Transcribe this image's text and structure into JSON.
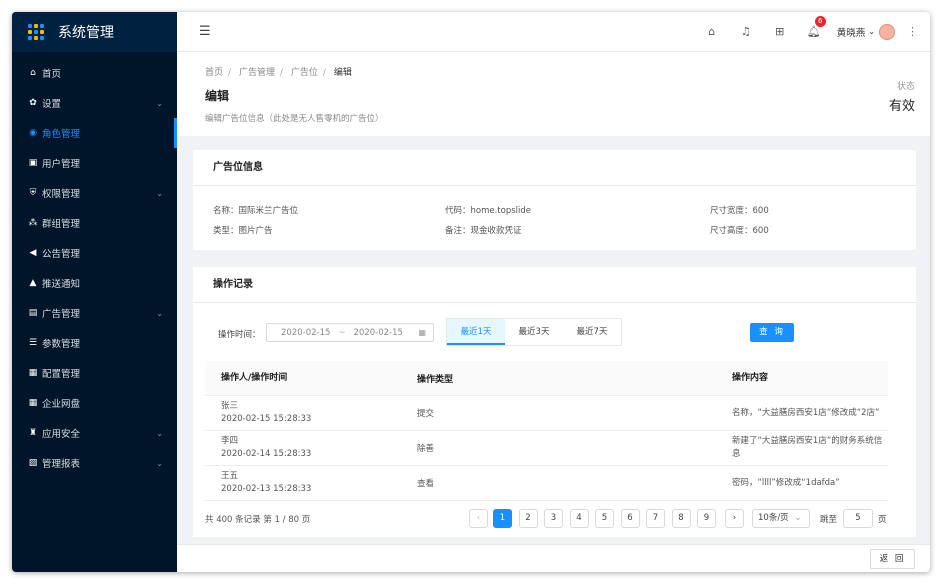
{
  "app": {
    "title": "系统管理"
  },
  "sidebar": {
    "items": [
      {
        "label": "首页",
        "icon": "home-icon",
        "glyph": "⌂",
        "has_children": false
      },
      {
        "label": "设置",
        "icon": "gear-icon",
        "glyph": "✿",
        "has_children": true
      },
      {
        "label": "角色管理",
        "icon": "user-circle-icon",
        "glyph": "◉",
        "has_children": false,
        "active": true
      },
      {
        "label": "用户管理",
        "icon": "id-card-icon",
        "glyph": "▣",
        "has_children": false
      },
      {
        "label": "权限管理",
        "icon": "shield-icon",
        "glyph": "⛨",
        "has_children": true
      },
      {
        "label": "群组管理",
        "icon": "group-icon",
        "glyph": "⁂",
        "has_children": false
      },
      {
        "label": "公告管理",
        "icon": "megaphone-icon",
        "glyph": "◀",
        "has_children": false
      },
      {
        "label": "推送通知",
        "icon": "bell-icon",
        "glyph": "▲",
        "has_children": false
      },
      {
        "label": "广告管理",
        "icon": "image-icon",
        "glyph": "▤",
        "has_children": true
      },
      {
        "label": "参数管理",
        "icon": "server-icon",
        "glyph": "☰",
        "has_children": false
      },
      {
        "label": "配置管理",
        "icon": "apps-icon",
        "glyph": "▦",
        "has_children": false
      },
      {
        "label": "企业网盘",
        "icon": "grid-icon",
        "glyph": "▦",
        "has_children": false
      },
      {
        "label": "应用安全",
        "icon": "flask-icon",
        "glyph": "♜",
        "has_children": true
      },
      {
        "label": "管理报表",
        "icon": "report-icon",
        "glyph": "▨",
        "has_children": true
      }
    ]
  },
  "header": {
    "notification_count": "6",
    "user_name": "黄晓燕",
    "accent": "#1890ff"
  },
  "breadcrumb": [
    "首页",
    "广告管理",
    "广告位",
    "编辑"
  ],
  "page": {
    "title": "编辑",
    "description": "编辑广告位信息（此处是无人售零机的广告位）",
    "status_label": "状态",
    "status_value": "有效"
  },
  "ad_info": {
    "title": "广告位信息",
    "name": "名称：国际米兰广告位",
    "type": "类型：图片广告",
    "code": "代码：home.topslide",
    "remark": "备注：现金收款凭证",
    "width": "尺寸宽度：600",
    "height": "尺寸高度：600"
  },
  "ops": {
    "title": "操作记录",
    "filter_label": "操作时间：",
    "date_start": "2020-02-15",
    "date_end": "2020-02-15",
    "quick_ranges": [
      "最近1天",
      "最近3天",
      "最近7天"
    ],
    "query_label": "查 询",
    "columns": [
      "操作人/操作时间",
      "操作类型",
      "操作内容"
    ],
    "rows": [
      {
        "user": "张三",
        "time": "2020-02-15 15:28:33",
        "type": "提交",
        "content": "名称，“大益膳房西安1店”修改成“2店”"
      },
      {
        "user": "李四",
        "time": "2020-02-14 15:28:33",
        "type": "除善",
        "content": "新建了“大益膳房西安1店”的财务系统信息"
      },
      {
        "user": "王五",
        "time": "2020-02-13 15:28:33",
        "type": "查看",
        "content": "密码，“llll”修改成“1dafda”"
      }
    ],
    "pagination": {
      "total_text": "共 400 条记录 第 1 / 80 页",
      "pages": [
        "1",
        "2",
        "3",
        "4",
        "5",
        "6",
        "7",
        "8",
        "9"
      ],
      "page_size": "10条/页",
      "jump_label": "跳至",
      "jump_value": "5",
      "jump_unit": "页"
    }
  },
  "footer": {
    "back_label": "返 回"
  }
}
